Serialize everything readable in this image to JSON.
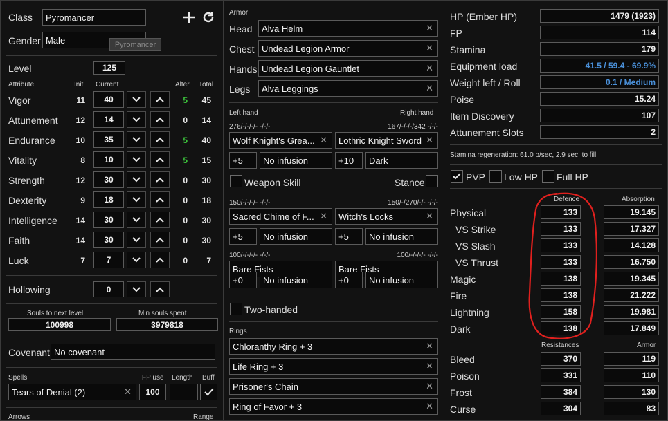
{
  "character": {
    "class_label": "Class",
    "class_value": "Pyromancer",
    "gender_label": "Gender",
    "gender_value": "Male",
    "tooltip": "Pyromancer",
    "level_label": "Level",
    "level_value": "125",
    "headers": {
      "attribute": "Attribute",
      "init": "Init",
      "current": "Current",
      "alter": "Alter",
      "total": "Total"
    },
    "attributes": [
      {
        "name": "Vigor",
        "init": "11",
        "current": "40",
        "alter": "5",
        "total": "45",
        "alter_green": true
      },
      {
        "name": "Attunement",
        "init": "12",
        "current": "14",
        "alter": "0",
        "total": "14",
        "alter_green": false
      },
      {
        "name": "Endurance",
        "init": "10",
        "current": "35",
        "alter": "5",
        "total": "40",
        "alter_green": true
      },
      {
        "name": "Vitality",
        "init": "8",
        "current": "10",
        "alter": "5",
        "total": "15",
        "alter_green": true
      },
      {
        "name": "Strength",
        "init": "12",
        "current": "30",
        "alter": "0",
        "total": "30",
        "alter_green": false
      },
      {
        "name": "Dexterity",
        "init": "9",
        "current": "18",
        "alter": "0",
        "total": "18",
        "alter_green": false
      },
      {
        "name": "Intelligence",
        "init": "14",
        "current": "30",
        "alter": "0",
        "total": "30",
        "alter_green": false
      },
      {
        "name": "Faith",
        "init": "14",
        "current": "30",
        "alter": "0",
        "total": "30",
        "alter_green": false
      },
      {
        "name": "Luck",
        "init": "7",
        "current": "7",
        "alter": "0",
        "total": "7",
        "alter_green": false
      }
    ],
    "hollowing_label": "Hollowing",
    "hollowing_value": "0",
    "souls_next_label": "Souls to next level",
    "souls_next_value": "100998",
    "min_souls_label": "Min souls spent",
    "min_souls_value": "3979818",
    "covenant_label": "Covenant",
    "covenant_value": "No covenant",
    "spells_label": "Spells",
    "fp_use_label": "FP use",
    "length_label": "Length",
    "buff_label": "Buff",
    "spell_value": "Tears of Denial (2)",
    "spell_fp": "100",
    "spell_length": "",
    "arrows_label": "Arrows",
    "range_label": "Range"
  },
  "equipment": {
    "armor_label": "Armor",
    "armor": [
      {
        "slot": "Head",
        "item": "Alva Helm"
      },
      {
        "slot": "Chest",
        "item": "Undead Legion Armor"
      },
      {
        "slot": "Hands",
        "item": "Undead Legion Gauntlet"
      },
      {
        "slot": "Legs",
        "item": "Alva Leggings"
      }
    ],
    "left_hand_label": "Left hand",
    "right_hand_label": "Right hand",
    "weapon_sets": [
      {
        "left_req": "276/-/-/-/-  -/-/-",
        "right_req": "167/-/-/-/342  -/-/-",
        "left_item": "Wolf Knight's Grea...",
        "right_item": "Lothric Knight Sword",
        "left_plus": "+5",
        "left_infusion": "No infusion",
        "right_plus": "+10",
        "right_infusion": "Dark"
      },
      {
        "left_req": "150/-/-/-/-  -/-/-",
        "right_req": "150/-/270/-/-  -/-/-",
        "left_item": "Sacred Chime of F...",
        "right_item": "Witch's Locks",
        "left_plus": "+5",
        "left_infusion": "No infusion",
        "right_plus": "+5",
        "right_infusion": "No infusion"
      },
      {
        "left_req": "100/-/-/-/-  -/-/-",
        "right_req": "100/-/-/-/-  -/-/-",
        "left_item": "Bare Fists",
        "right_item": "Bare Fists",
        "left_plus": "+0",
        "left_infusion": "No infusion",
        "right_plus": "+0",
        "right_infusion": "No infusion"
      }
    ],
    "weapon_skill_label": "Weapon Skill",
    "stance_label": "Stance",
    "two_handed_label": "Two-handed",
    "rings_label": "Rings",
    "rings": [
      "Chloranthy Ring + 3",
      "Life Ring + 3",
      "Prisoner's Chain",
      "Ring of Favor + 3"
    ]
  },
  "stats": {
    "rows": [
      {
        "label": "HP (Ember HP)",
        "value": "1479 (1923)",
        "color": ""
      },
      {
        "label": "FP",
        "value": "114",
        "color": ""
      },
      {
        "label": "Stamina",
        "value": "179",
        "color": ""
      },
      {
        "label": "Equipment load",
        "value": "41.5 / 59.4 - 69.9%",
        "color": "#4a90d9"
      },
      {
        "label": "Weight left / Roll",
        "value": "0.1 / Medium",
        "color": "#4a90d9"
      },
      {
        "label": "Poise",
        "value": "15.24",
        "color": ""
      },
      {
        "label": "Item Discovery",
        "value": "107",
        "color": ""
      },
      {
        "label": "Attunement Slots",
        "value": "2",
        "color": ""
      }
    ],
    "stamina_regen": "Stamina regeneration: 61.0 p/sec, 2.9 sec. to fill",
    "pvp_label": "PVP",
    "low_hp_label": "Low HP",
    "full_hp_label": "Full HP",
    "defence_label": "Defence",
    "absorption_label": "Absorption",
    "defence": [
      {
        "label": "Physical",
        "defence": "133",
        "absorption": "19.145"
      },
      {
        "label": "VS Strike",
        "defence": "133",
        "absorption": "17.327"
      },
      {
        "label": "VS Slash",
        "defence": "133",
        "absorption": "14.128"
      },
      {
        "label": "VS Thrust",
        "defence": "133",
        "absorption": "16.750"
      },
      {
        "label": "Magic",
        "defence": "138",
        "absorption": "19.345"
      },
      {
        "label": "Fire",
        "defence": "138",
        "absorption": "21.222"
      },
      {
        "label": "Lightning",
        "defence": "158",
        "absorption": "19.981"
      },
      {
        "label": "Dark",
        "defence": "138",
        "absorption": "17.849"
      }
    ],
    "resistances_label": "Resistances",
    "armor_label": "Armor",
    "resistances": [
      {
        "label": "Bleed",
        "resist": "370",
        "armor": "119"
      },
      {
        "label": "Poison",
        "resist": "331",
        "armor": "110"
      },
      {
        "label": "Frost",
        "resist": "384",
        "armor": "130"
      },
      {
        "label": "Curse",
        "resist": "304",
        "armor": "83"
      }
    ],
    "highlight_color": "#e0201e"
  }
}
